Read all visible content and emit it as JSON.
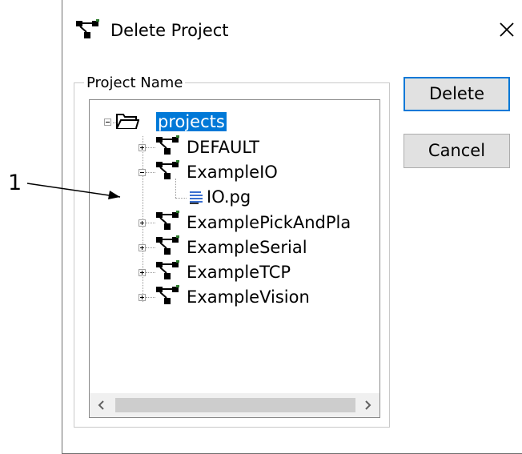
{
  "dialog": {
    "title": "Delete Project",
    "close_icon": "close-icon",
    "group_label": "Project Name",
    "buttons": {
      "delete_label": "Delete",
      "cancel_label": "Cancel"
    }
  },
  "tree": {
    "root": {
      "label": "projects",
      "expanded": true,
      "selected": true,
      "icon": "folder-icon"
    },
    "items": [
      {
        "label": "DEFAULT",
        "expanded": false,
        "icon": "project-icon"
      },
      {
        "label": "ExampleIO",
        "expanded": true,
        "icon": "project-icon"
      },
      {
        "label": "IO.pg",
        "icon": "program-file-icon"
      },
      {
        "label": "ExamplePickAndPla",
        "expanded": false,
        "icon": "project-icon"
      },
      {
        "label": "ExampleSerial",
        "expanded": false,
        "icon": "project-icon"
      },
      {
        "label": "ExampleTCP",
        "expanded": false,
        "icon": "project-icon"
      },
      {
        "label": "ExampleVision",
        "expanded": false,
        "icon": "project-icon"
      }
    ]
  },
  "scrollbar": {
    "left_arrow": "<",
    "right_arrow": ">"
  },
  "callout": {
    "number": "1"
  },
  "colors": {
    "selection": "#0078d7",
    "button_face": "#e1e1e1",
    "default_border": "#0078d7"
  }
}
